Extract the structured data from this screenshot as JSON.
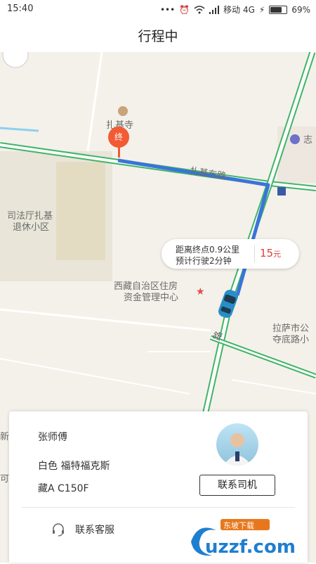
{
  "status_bar": {
    "time": "15:40",
    "carrier": "移动 4G",
    "battery_percent": "69%",
    "battery_level": 0.69
  },
  "header": {
    "title": "行程中"
  },
  "map": {
    "labels": {
      "temple": "扎基寺",
      "road_east": "扎基东路",
      "community_line1": "司法厅扎基",
      "community_line2": "退休小区",
      "center_line1": "西藏自治区住房",
      "center_line2": "资金管理中心",
      "lhasa_line1": "拉萨市公",
      "lhasa_line2": "夺底路小",
      "right_edge": "志",
      "road_lu": "路",
      "left_edge1": "新",
      "left_edge2": "可"
    },
    "destination_marker": "终",
    "trip_info": {
      "distance": "距离终点0.9公里",
      "duration": "预计行驶2分钟",
      "price": "15",
      "price_unit": "元"
    }
  },
  "driver_card": {
    "driver_name": "张师傅",
    "car_desc": "白色   福特福克斯",
    "plate": "藏A   C150F",
    "contact_driver_label": "联系司机",
    "customer_service_label": "联系客服"
  },
  "watermark": {
    "brand": "uzzf.com",
    "tag": "东坡下载"
  }
}
